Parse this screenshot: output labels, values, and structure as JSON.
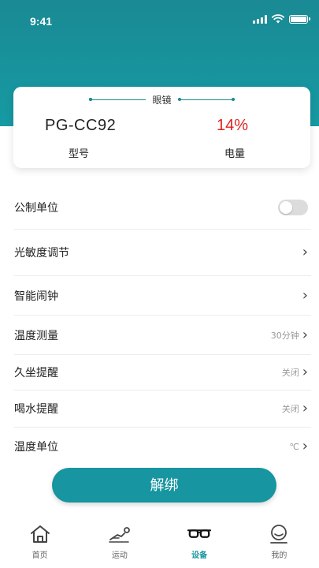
{
  "status_bar": {
    "time": "9:41"
  },
  "device_card": {
    "title": "眼镜",
    "model_value": "PG-CC92",
    "model_label": "型号",
    "battery_value": "14%",
    "battery_label": "电量",
    "battery_color": "#e0221f"
  },
  "settings": [
    {
      "label": "公制单位",
      "control": "toggle",
      "toggle_on": false
    },
    {
      "label": "光敏度调节",
      "value": ""
    },
    {
      "label": "智能闹钟",
      "value": ""
    },
    {
      "label": "温度测量",
      "value": "30分钟"
    },
    {
      "label": "久坐提醒",
      "value": "关闭"
    },
    {
      "label": "喝水提醒",
      "value": "关闭"
    },
    {
      "label": "温度单位",
      "value": "℃"
    }
  ],
  "unbind_label": "解绑",
  "tabbar": {
    "items": [
      {
        "label": "首页",
        "icon": "home-icon"
      },
      {
        "label": "运动",
        "icon": "running-icon"
      },
      {
        "label": "设备",
        "icon": "glasses-icon",
        "active": true
      },
      {
        "label": "我的",
        "icon": "profile-icon"
      }
    ]
  },
  "colors": {
    "accent": "#1795a0",
    "header": "#1a8a94"
  }
}
